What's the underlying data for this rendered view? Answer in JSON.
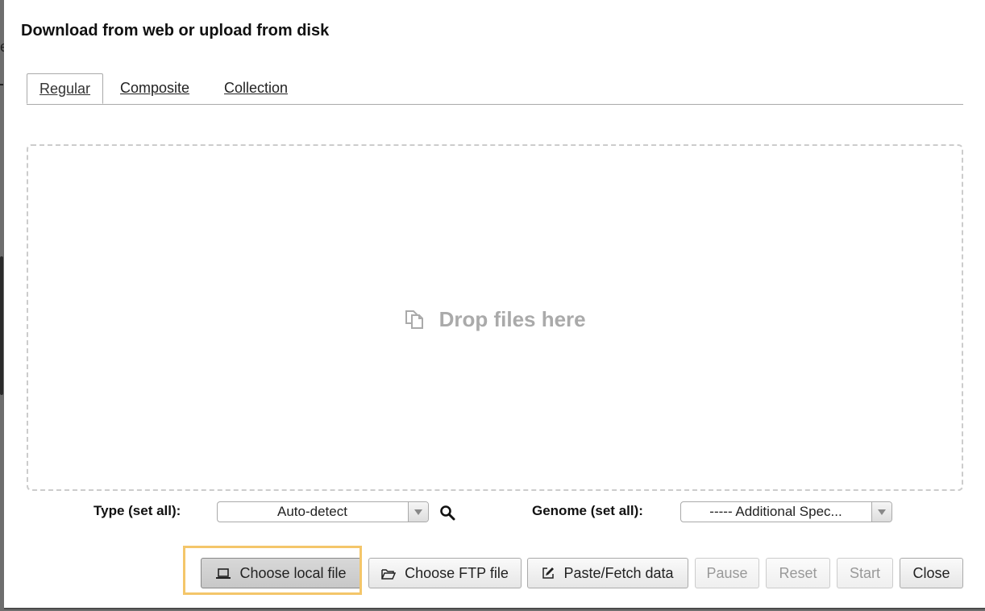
{
  "dialog": {
    "title": "Download from web or upload from disk"
  },
  "tabs": [
    {
      "label": "Regular",
      "active": true
    },
    {
      "label": "Composite",
      "active": false
    },
    {
      "label": "Collection",
      "active": false
    }
  ],
  "dropzone": {
    "message": "Drop files here",
    "icon": "copy-files-icon"
  },
  "type_setting": {
    "label": "Type (set all):",
    "value": "Auto-detect"
  },
  "genome_setting": {
    "label": "Genome (set all):",
    "value": "----- Additional Spec..."
  },
  "buttons": {
    "choose_local": {
      "label": "Choose local file",
      "icon": "laptop-icon"
    },
    "choose_ftp": {
      "label": "Choose FTP file",
      "icon": "folder-open-icon"
    },
    "paste_fetch": {
      "label": "Paste/Fetch data",
      "icon": "edit-icon"
    },
    "pause": {
      "label": "Pause",
      "disabled": true
    },
    "reset": {
      "label": "Reset",
      "disabled": true
    },
    "start": {
      "label": "Start",
      "disabled": true
    },
    "close": {
      "label": "Close"
    }
  },
  "colors": {
    "highlight": "#f4c66a",
    "dropzone_border": "#cccccc",
    "disabled_text": "#999999"
  }
}
